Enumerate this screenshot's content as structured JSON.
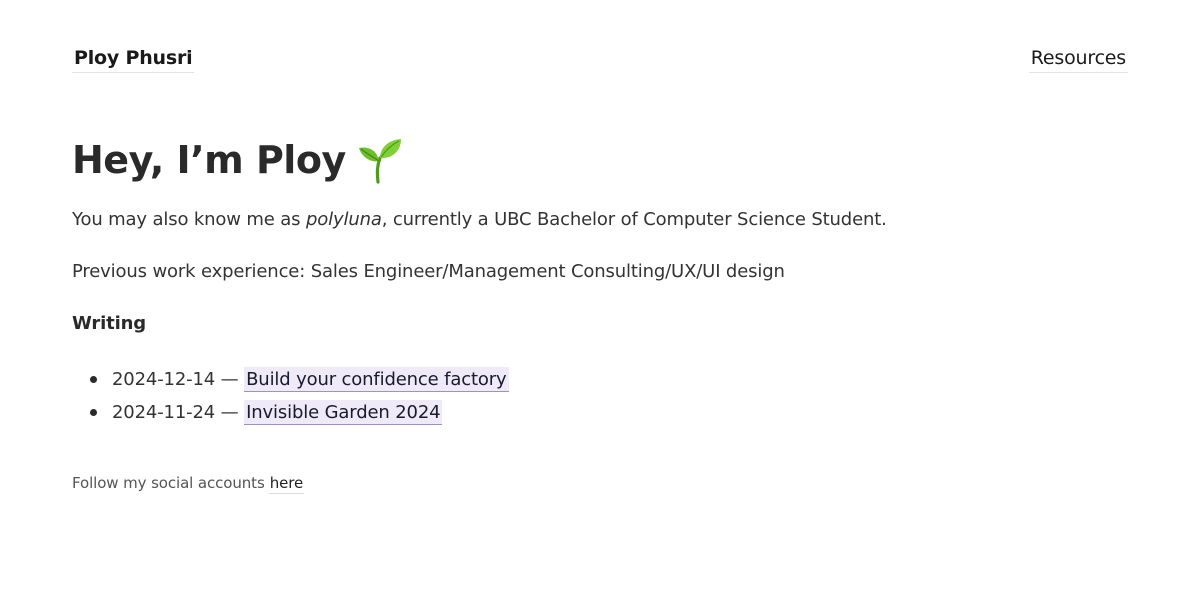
{
  "header": {
    "site_name": "Ploy Phusri",
    "nav": {
      "resources_label": "Resources"
    }
  },
  "main": {
    "title": "Hey, I’m Ploy",
    "title_icon": "seedling-icon",
    "intro": {
      "before": "You may also know me as ",
      "alias": "polyluna",
      "after": ", currently a UBC Bachelor of Computer Science Student."
    },
    "work_experience": "Previous work experience: Sales Engineer/Management Consulting/UX/UI design",
    "writing": {
      "heading": "Writing",
      "posts": [
        {
          "date": "2024-12-14",
          "separator": " — ",
          "title": "Build your confidence factory"
        },
        {
          "date": "2024-11-24",
          "separator": " — ",
          "title": "Invisible Garden 2024"
        }
      ]
    }
  },
  "footer": {
    "text": "Follow my social accounts",
    "link_label": "here"
  },
  "colors": {
    "link_highlight": "#eeeaf8",
    "link_underline": "#9b92c8",
    "text": "#2a2a2a"
  }
}
